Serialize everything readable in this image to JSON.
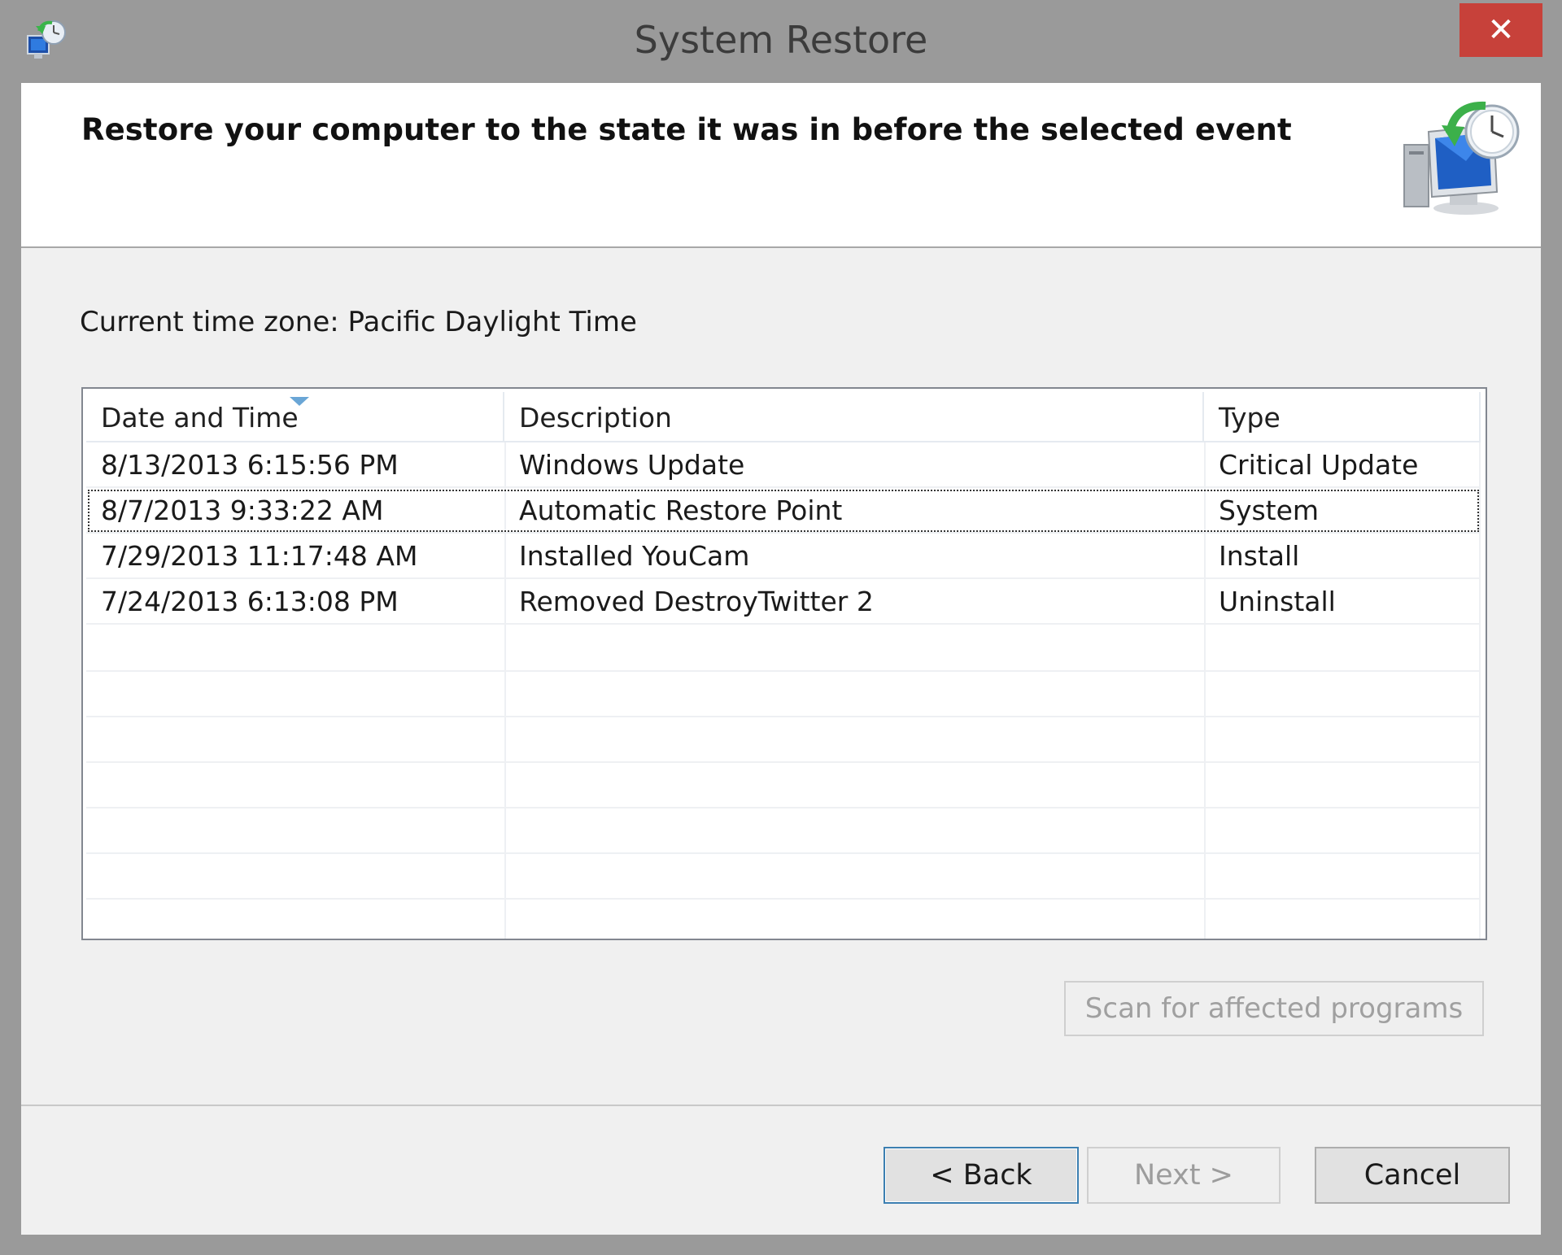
{
  "window": {
    "title": "System Restore",
    "close_glyph": "✕"
  },
  "header": {
    "title": "Restore your computer to the state it was in before the selected event"
  },
  "timezone": {
    "label": "Current time zone: Pacific Daylight Time"
  },
  "table": {
    "columns": [
      "Date and Time",
      "Description",
      "Type"
    ],
    "sorted_column": "Date and Time",
    "rows": [
      {
        "date": "8/13/2013 6:15:56 PM",
        "description": "Windows Update",
        "type": "Critical Update"
      },
      {
        "date": "8/7/2013 9:33:22 AM",
        "description": "Automatic Restore Point",
        "type": "System"
      },
      {
        "date": "7/29/2013 11:17:48 AM",
        "description": "Installed YouCam",
        "type": "Install"
      },
      {
        "date": "7/24/2013 6:13:08 PM",
        "description": "Removed DestroyTwitter 2",
        "type": "Uninstall"
      }
    ]
  },
  "buttons": {
    "scan": "Scan for affected programs",
    "back": "< Back",
    "next": "Next >",
    "cancel": "Cancel"
  },
  "colors": {
    "close_button": "#c7413a",
    "focus_border": "#3c7fb1",
    "frame": "#9a9a9a"
  },
  "icons": {
    "app": "system-restore-icon",
    "header": "computer-restore-clock-icon"
  }
}
